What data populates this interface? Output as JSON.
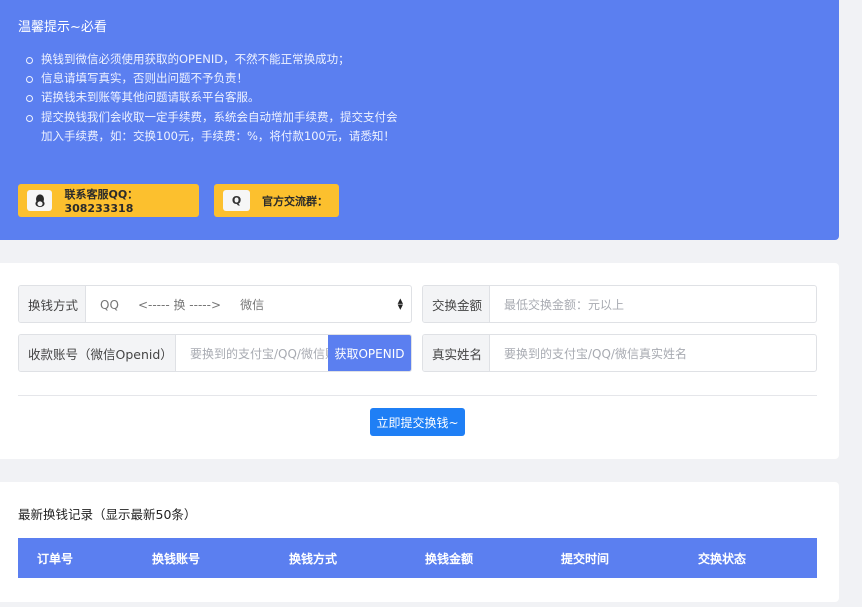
{
  "notice": {
    "title": "温馨提示~必看",
    "items": [
      "换钱到微信必须使用获取的OPENID，不然不能正常换成功；",
      "信息请填写真实，否则出问题不予负责！",
      "诺换钱未到账等其他问题请联系平台客服。",
      "提交换钱我们会收取一定手续费，系统会自动增加手续费，提交支付会加入手续费，如：交换100元，手续费：%，将付款100元，请悉知！"
    ],
    "contact_qq_label": "联系客服QQ：308233318",
    "group_label": "官方交流群：",
    "qq_icon": "penguin-icon",
    "group_icon": "Q"
  },
  "form": {
    "method_label": "换钱方式",
    "method_value": "QQ     <----- 换 ----->     微信",
    "amount_label": "交换金额",
    "amount_placeholder": "最低交换金额：元以上",
    "account_label": "收款账号（微信Openid）",
    "account_placeholder": "要换到的支付宝/QQ/微信账号",
    "get_openid_label": "获取OPENID",
    "name_label": "真实姓名",
    "name_placeholder": "要换到的支付宝/QQ/微信真实姓名",
    "submit_label": "立即提交换钱~"
  },
  "records": {
    "title": "最新换钱记录（显示最新50条）",
    "columns": [
      "订单号",
      "换钱账号",
      "换钱方式",
      "换钱金额",
      "提交时间",
      "交换状态"
    ]
  },
  "colors": {
    "primary": "#5b7ff0",
    "accent_yellow": "#fcc02e",
    "submit_blue": "#1f7ff5"
  }
}
